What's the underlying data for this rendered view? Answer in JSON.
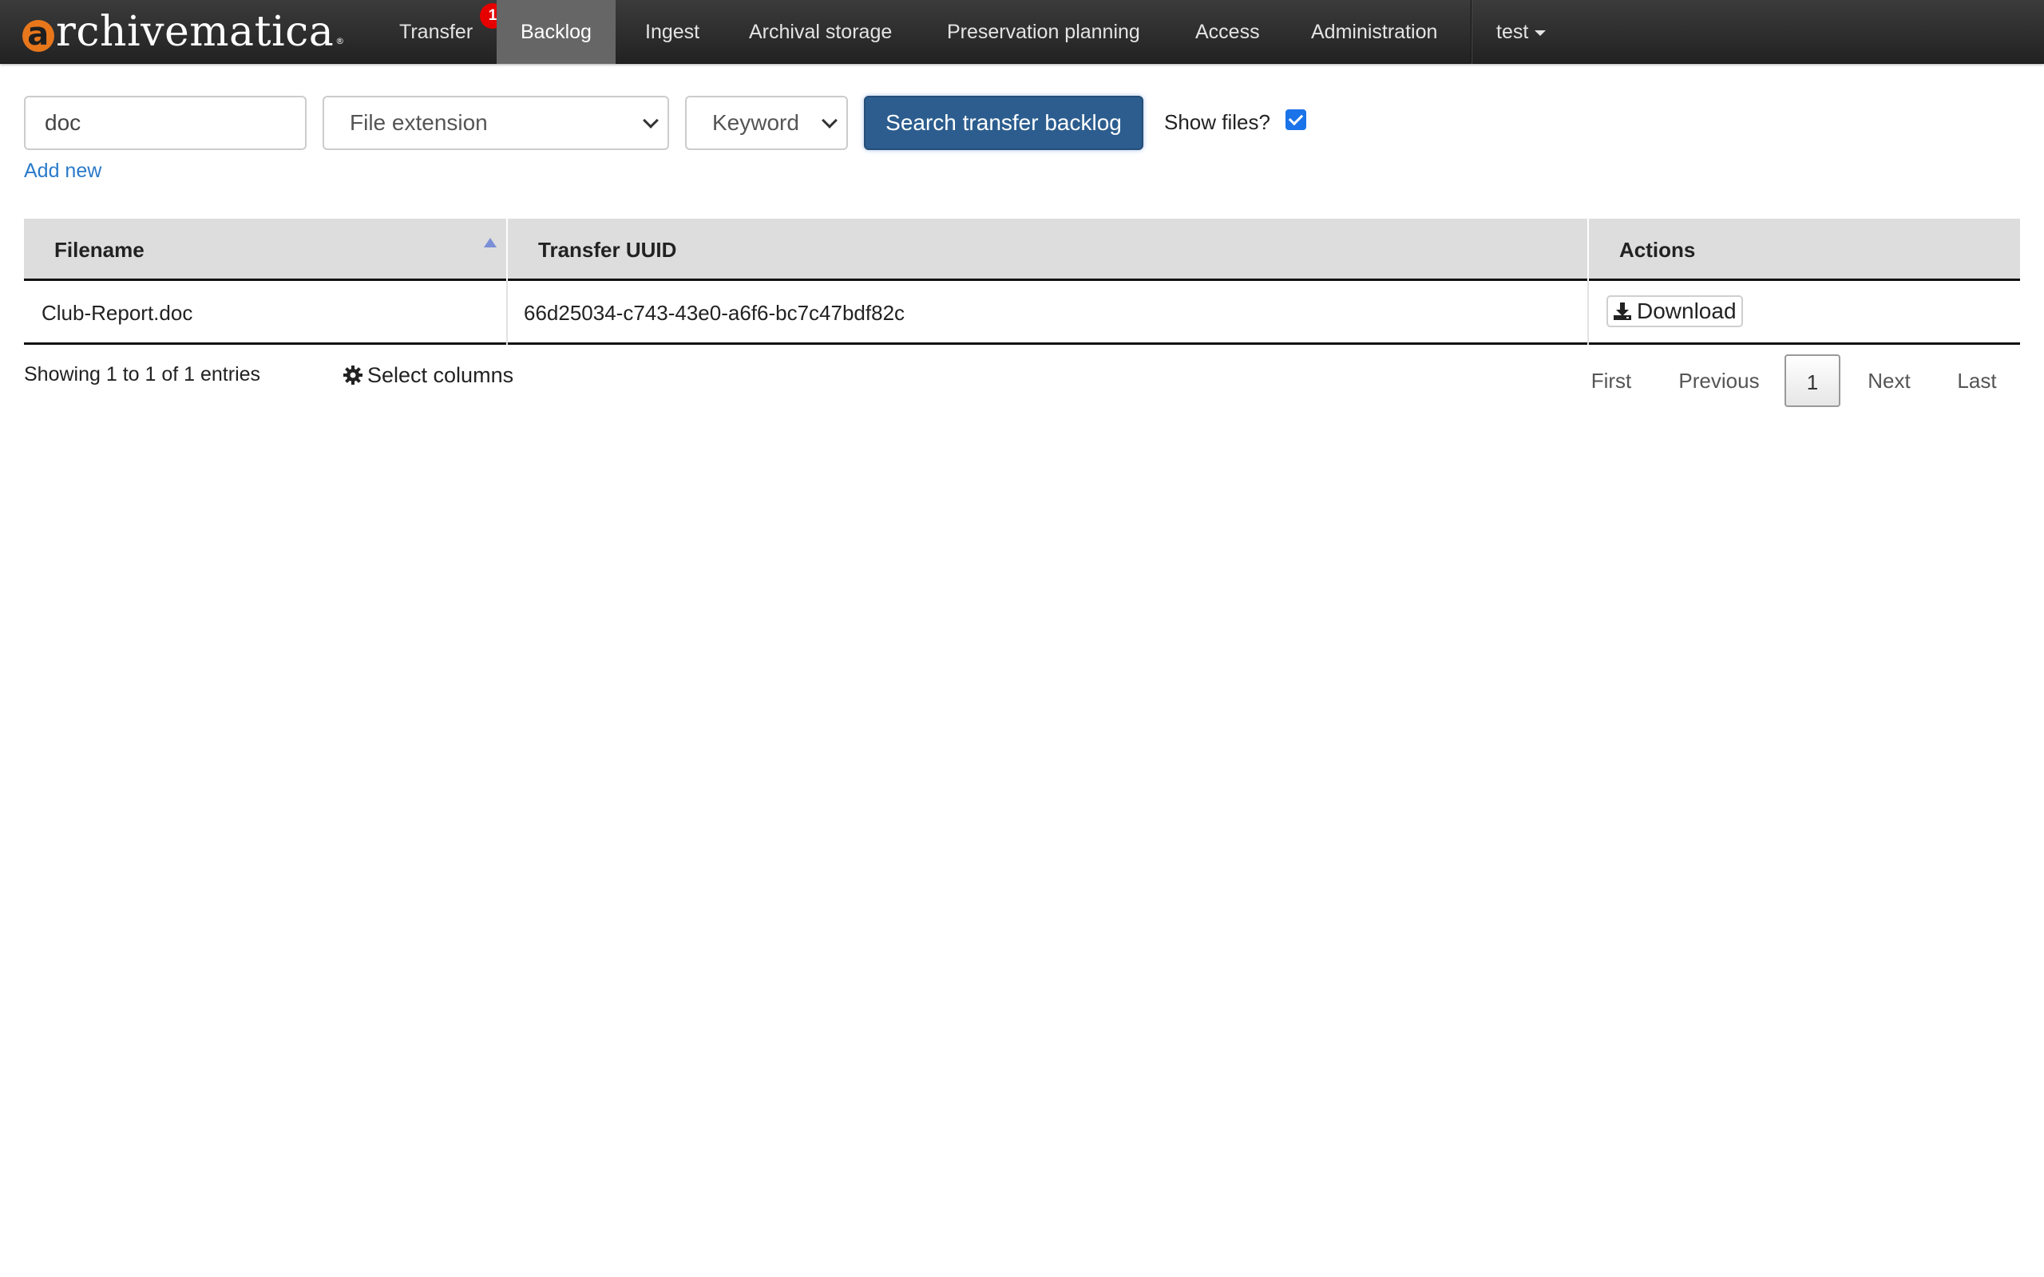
{
  "navbar": {
    "brand": {
      "mark": "a",
      "text": "rchivematica",
      "reg": "®"
    },
    "items": [
      {
        "label": "Transfer",
        "badge": "1"
      },
      {
        "label": "Backlog"
      },
      {
        "label": "Ingest"
      },
      {
        "label": "Archival storage"
      },
      {
        "label": "Preservation planning"
      },
      {
        "label": "Access"
      },
      {
        "label": "Administration"
      }
    ],
    "user": "test"
  },
  "search": {
    "query_value": "doc",
    "field_select": "File extension",
    "type_select": "Keyword",
    "button_label": "Search transfer backlog",
    "show_files_label": "Show files?",
    "show_files_checked": true,
    "add_new_label": "Add new"
  },
  "table": {
    "columns": [
      "Filename",
      "Transfer UUID",
      "Actions"
    ],
    "rows": [
      {
        "filename": "Club-Report.doc",
        "uuid": "66d25034-c743-43e0-a6f6-bc7c47bdf82c",
        "action": "Download"
      }
    ]
  },
  "footer": {
    "info": "Showing 1 to 1 of 1 entries",
    "select_columns_label": "Select columns",
    "pagination": {
      "first": "First",
      "previous": "Previous",
      "current": "1",
      "next": "Next",
      "last": "Last"
    }
  },
  "colors": {
    "navbar": "#2b2b2b",
    "active_tab": "#666666",
    "primary_button": "#2c5d8e",
    "link": "#2a7ac9",
    "badge": "#e60000",
    "brand_accent": "#e8771c"
  }
}
